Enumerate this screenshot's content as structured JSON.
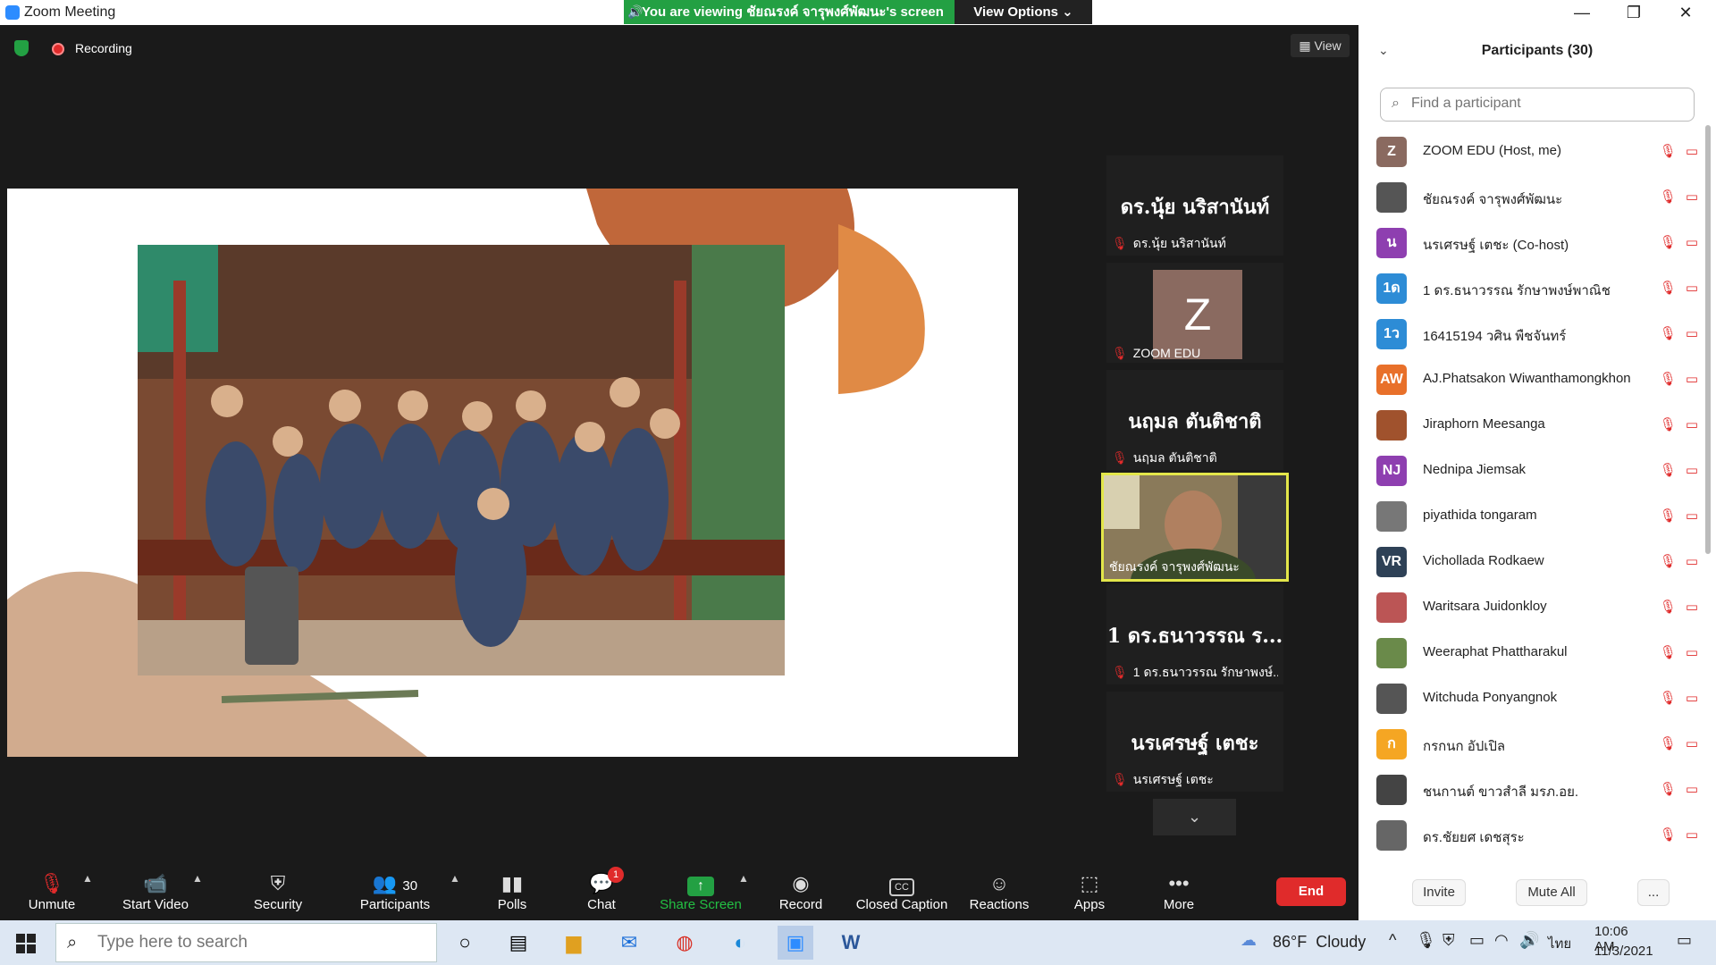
{
  "window": {
    "title": "Zoom Meeting",
    "minimize": "—",
    "maximize": "❐",
    "close": "✕"
  },
  "banner": {
    "text": "You are viewing ชัยณรงค์ จารุพงศ์พัฒนะ's screen",
    "view_options": "View Options ⌄"
  },
  "meeting": {
    "recording_label": "Recording",
    "view_label": "View"
  },
  "gallery": [
    {
      "big": "ดร.นุ้ย นริสานันท์",
      "name": "ดร.นุ้ย นริสานันท์"
    },
    {
      "big": "Z",
      "name": "ZOOM EDU"
    },
    {
      "big": "นฤมล ตันติชาติ",
      "name": "นฤมล ตันติชาติ"
    },
    {
      "big": "",
      "name": "ชัยณรงค์ จารุพงศ์พัฒนะ"
    },
    {
      "big": "1 ดร.ธนาวรรณ ร...",
      "name": "1 ดร.ธนาวรรณ รักษาพงษ์..."
    },
    {
      "big": "นรเศรษฐ์ เตชะ",
      "name": "นรเศรษฐ์ เตชะ"
    }
  ],
  "toolbar": {
    "unmute": "Unmute",
    "start_video": "Start Video",
    "security": "Security",
    "participants": "Participants",
    "participants_count": "30",
    "polls": "Polls",
    "chat": "Chat",
    "chat_badge": "1",
    "share_screen": "Share Screen",
    "record": "Record",
    "closed_caption": "Closed Caption",
    "cc_icon": "CC",
    "reactions": "Reactions",
    "apps": "Apps",
    "more": "More",
    "end": "End"
  },
  "panel": {
    "title": "Participants (30)",
    "search_placeholder": "Find a participant",
    "participants": [
      {
        "name": "ZOOM EDU (Host, me)",
        "initials": "Z",
        "color": "#8a6a60"
      },
      {
        "name": "ชัยณรงค์ จารุพงศ์พัฒนะ",
        "initials": "",
        "color": "#555555"
      },
      {
        "name": "นรเศรษฐ์ เตชะ (Co-host)",
        "initials": "น",
        "color": "#8e3fb0"
      },
      {
        "name": "1 ดร.ธนาวรรณ รักษาพงษ์พาณิช",
        "initials": "1ด",
        "color": "#2d8cd6"
      },
      {
        "name": "16415194 วศิน พืชจันทร์",
        "initials": "1ว",
        "color": "#2d8cd6"
      },
      {
        "name": "AJ.Phatsakon Wiwanthamongkhon",
        "initials": "AW",
        "color": "#e8702a"
      },
      {
        "name": "Jiraphorn Meesanga",
        "initials": "",
        "color": "#a0522d"
      },
      {
        "name": "Nednipa Jiemsak",
        "initials": "NJ",
        "color": "#8e3fb0"
      },
      {
        "name": "piyathida tongaram",
        "initials": "",
        "color": "#777777"
      },
      {
        "name": "Vichollada Rodkaew",
        "initials": "VR",
        "color": "#2e4156"
      },
      {
        "name": "Waritsara Juidonkloy",
        "initials": "",
        "color": "#b55"
      },
      {
        "name": "Weeraphat Phattharakul",
        "initials": "",
        "color": "#6a8a4a"
      },
      {
        "name": "Witchuda Ponyangnok",
        "initials": "",
        "color": "#555"
      },
      {
        "name": "กรกนก อัปเปิล",
        "initials": "ก",
        "color": "#f5a623"
      },
      {
        "name": "ชนกานต์ ขาวสำลี มรภ.อย.",
        "initials": "",
        "color": "#444"
      },
      {
        "name": "ดร.ชัยยศ เดชสุระ",
        "initials": "",
        "color": "#666"
      }
    ],
    "invite": "Invite",
    "mute_all": "Mute All",
    "more": "..."
  },
  "taskbar": {
    "search_placeholder": "Type here to search",
    "weather": "86°F  Cloudy",
    "lang": "ไทย",
    "time": "10:06 AM",
    "date": "11/3/2021"
  }
}
